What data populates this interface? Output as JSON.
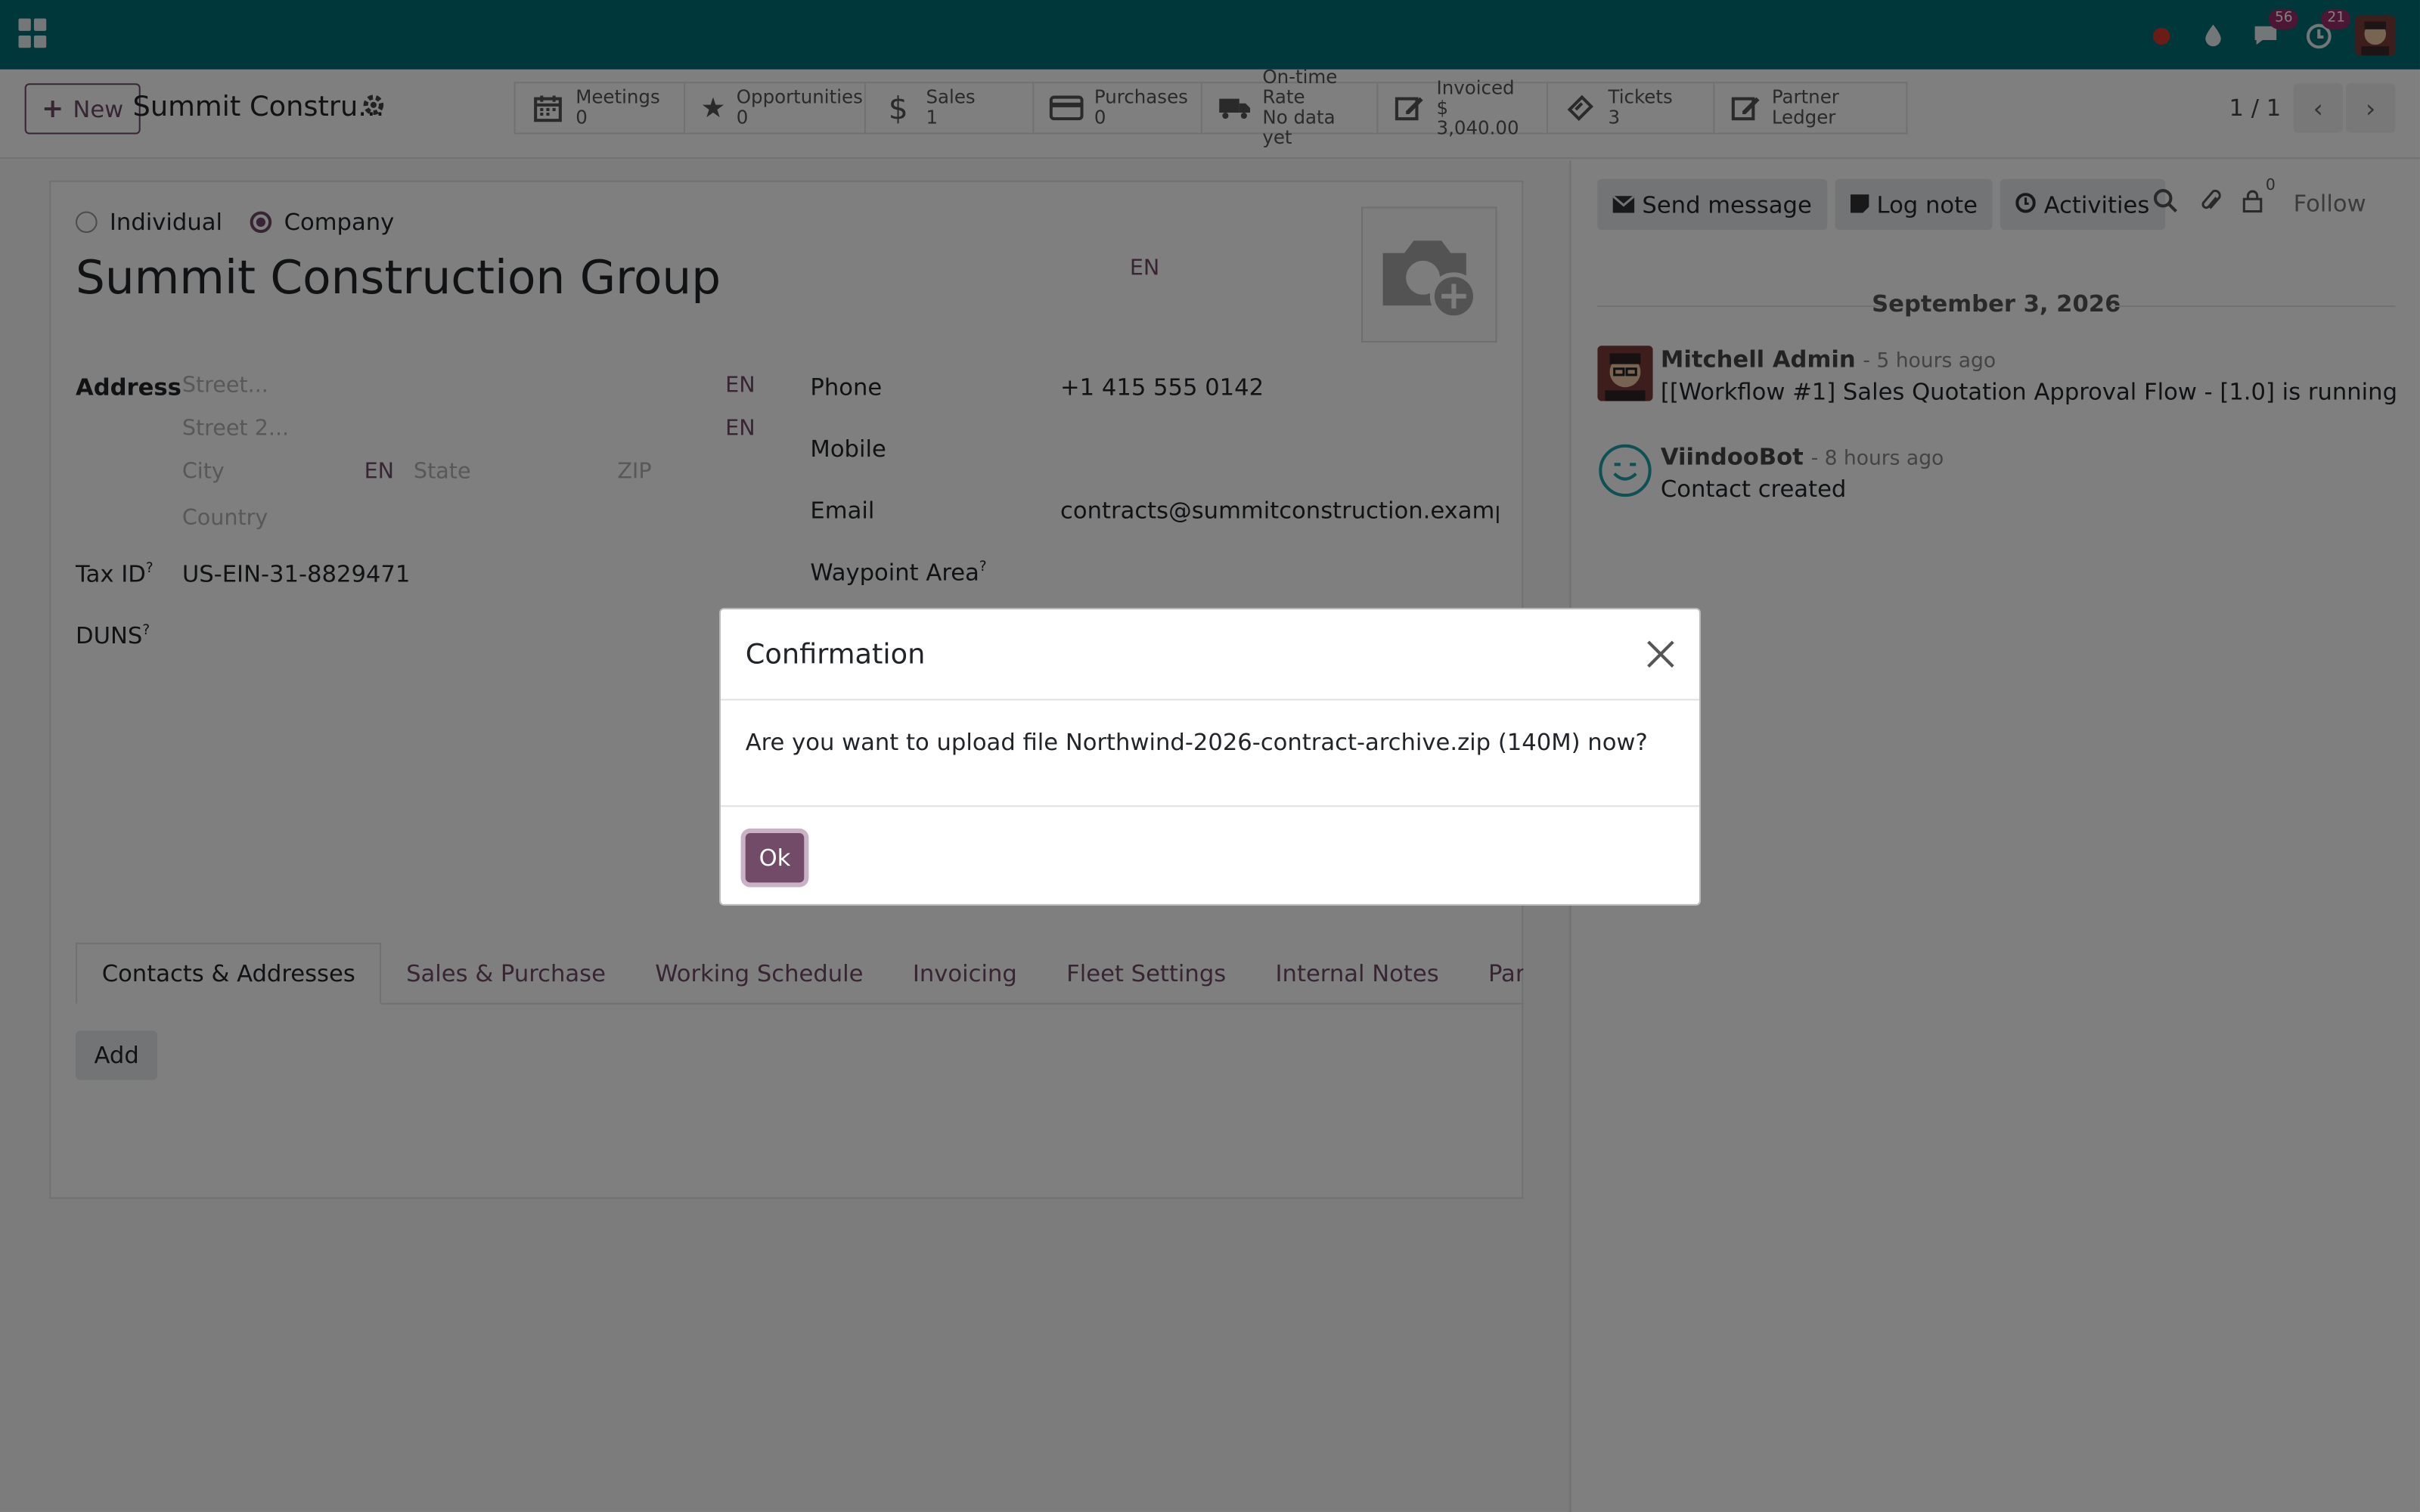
{
  "navbar": {
    "messages_count": "56",
    "activities_count": "21"
  },
  "control": {
    "new_label": "New",
    "record_title": "Summit Constru...",
    "pager": "1 / 1",
    "smart_buttons": [
      {
        "label": "Meetings",
        "value": "0"
      },
      {
        "label": "Opportunities",
        "value": "0"
      },
      {
        "label": "Sales",
        "value": "1"
      },
      {
        "label": "Purchases",
        "value": "0"
      },
      {
        "label": "On-time Rate",
        "value": "No data yet"
      },
      {
        "label": "Invoiced",
        "value": "$ 3,040.00"
      },
      {
        "label": "Tickets",
        "value": "3"
      },
      {
        "label": "Partner Ledger",
        "value": ""
      }
    ]
  },
  "form": {
    "individual_label": "Individual",
    "company_label": "Company",
    "company_name": "Summit Construction Group",
    "lang_code": "EN",
    "address_label": "Address",
    "street_placeholder": "Street...",
    "street2_placeholder": "Street 2...",
    "city_placeholder": "City",
    "state_placeholder": "State",
    "zip_placeholder": "ZIP",
    "country_placeholder": "Country",
    "taxid_label": "Tax ID",
    "taxid_value": "US-EIN-31-8829471",
    "duns_label": "DUNS",
    "help_mark": "?",
    "phone_label": "Phone",
    "phone_value": "+1 415 555 0142",
    "mobile_label": "Mobile",
    "email_label": "Email",
    "email_value": "contracts@summitconstruction.example.com",
    "waypoint_label": "Waypoint Area",
    "tabs": [
      "Contacts & Addresses",
      "Sales & Purchase",
      "Working Schedule",
      "Invoicing",
      "Fleet Settings",
      "Internal Notes",
      "Partner Assignm"
    ],
    "add_label": "Add"
  },
  "chatter": {
    "send_message": "Send message",
    "log_note": "Log note",
    "activities": "Activities",
    "followers_count": "0",
    "follow": "Follow",
    "date": "September 3, 2026",
    "messages": [
      {
        "author": "Mitchell Admin",
        "ago": "- 5 hours ago",
        "text": "[[Workflow #1] Sales Quotation Approval Flow - [1.0] is running"
      },
      {
        "author": "ViindooBot",
        "ago": "- 8 hours ago",
        "text": "Contact created"
      }
    ]
  },
  "dialog": {
    "title": "Confirmation",
    "message": "Are you want to upload file Northwind-2026-contract-archive.zip (140M) now?",
    "ok_label": "Ok"
  },
  "colors": {
    "navbar": "#016e74",
    "primary": "#714b67"
  }
}
